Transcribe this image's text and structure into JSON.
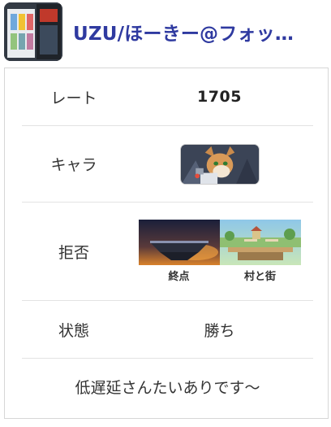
{
  "header": {
    "username": "UZU/ほーきー@フォッ…",
    "avatar_icon": "avatar-image"
  },
  "card": {
    "rate_label": "レート",
    "rate_value": "1705",
    "character_label": "キャラ",
    "character_icon": "fox-character-icon",
    "reject_label": "拒否",
    "stages": [
      {
        "name": "終点",
        "icon": "final-destination-stage-icon"
      },
      {
        "name": "村と街",
        "icon": "town-and-city-stage-icon"
      }
    ],
    "status_label": "状態",
    "status_value": "勝ち",
    "comment": "低遅延さんたいありです〜"
  },
  "colors": {
    "username": "#2f3aa0",
    "card_border": "#d6d6d6",
    "divider": "#e3e3e3"
  }
}
